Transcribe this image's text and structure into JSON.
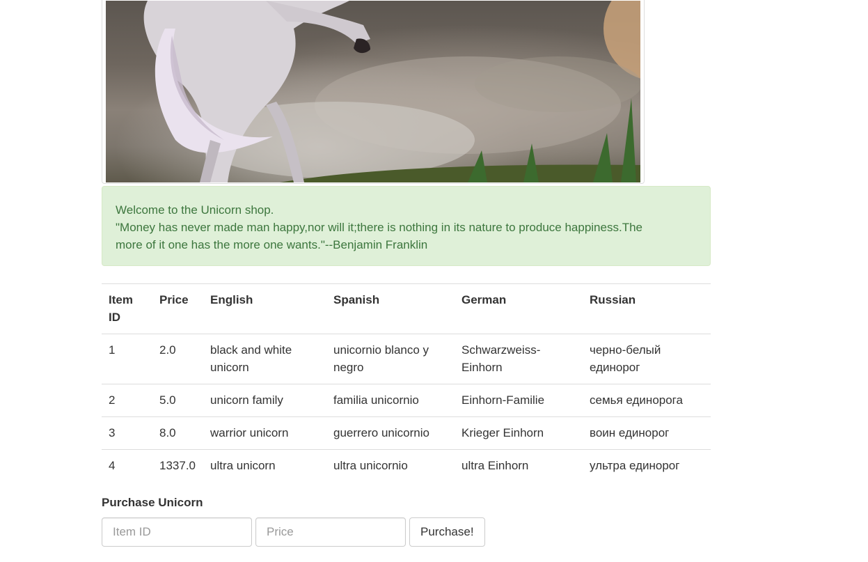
{
  "hero": {
    "image_name": "unicorn-image"
  },
  "alert": {
    "welcome": "Welcome to the Unicorn shop.",
    "quote": "\"Money has never made man happy,nor will it;there is nothing in its nature to produce happiness.The more of it one has the more one wants.\"--Benjamin Franklin"
  },
  "table": {
    "headers": [
      "Item ID",
      "Price",
      "English",
      "Spanish",
      "German",
      "Russian"
    ],
    "rows": [
      {
        "id": "1",
        "price": "2.0",
        "english": "black and white unicorn",
        "spanish": "unicornio blanco y negro",
        "german": "Schwarzweiss-Einhorn",
        "russian": "черно-белый единорог"
      },
      {
        "id": "2",
        "price": "5.0",
        "english": "unicorn family",
        "spanish": "familia unicornio",
        "german": "Einhorn-Familie",
        "russian": "семья единорога"
      },
      {
        "id": "3",
        "price": "8.0",
        "english": "warrior unicorn",
        "spanish": "guerrero unicornio",
        "german": "Krieger Einhorn",
        "russian": "воин единорог"
      },
      {
        "id": "4",
        "price": "1337.0",
        "english": "ultra unicorn",
        "spanish": "ultra unicornio",
        "german": "ultra Einhorn",
        "russian": "ультра единорог"
      }
    ]
  },
  "purchase": {
    "title": "Purchase Unicorn",
    "item_id_placeholder": "Item ID",
    "price_placeholder": "Price",
    "item_id_value": "",
    "price_value": "",
    "button_label": "Purchase!"
  },
  "colors": {
    "alert_bg": "#dff0d8",
    "alert_text": "#3c763d",
    "border": "#dddddd"
  }
}
